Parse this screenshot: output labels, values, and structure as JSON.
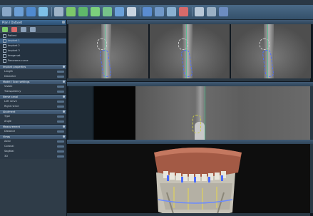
{
  "menu": [
    "",
    "",
    "",
    "",
    "",
    "",
    "",
    "",
    "",
    "",
    ""
  ],
  "toolbar": {
    "icons": [
      "open-icon",
      "save-icon",
      "import-icon",
      "export-icon",
      "layout-icon",
      "tooth-icon",
      "implant-icon",
      "nerve-icon",
      "crown-icon",
      "panorama-icon",
      "measure-icon",
      "move-icon",
      "zoom-icon",
      "pan-icon",
      "rotate-icon",
      "settings-icon",
      "print-icon",
      "help-icon"
    ]
  },
  "left_panel": {
    "title": "Plan / Dataset",
    "tree": [
      "Patient",
      "Implant 1",
      "Implant 2",
      "Implant 3",
      "Image set",
      "Panorama curve"
    ],
    "sections": [
      {
        "title": "Implant properties",
        "rows": [
          "Length",
          "Diameter"
        ]
      },
      {
        "title": "Model / Scan settings",
        "rows": [
          "Visible",
          "Transparency"
        ]
      },
      {
        "title": "Nerve canal",
        "rows": [
          "Left nerve",
          "Right nerve"
        ]
      },
      {
        "title": "Abutment",
        "rows": [
          "Type",
          "Angle"
        ]
      },
      {
        "title": "Measurement",
        "rows": [
          "Distance"
        ]
      },
      {
        "title": "Views",
        "rows": [
          "Axial",
          "Coronal",
          "Sagittal",
          "3D"
        ]
      }
    ]
  },
  "views": {
    "top_label": "",
    "middle_marker": "P",
    "bottom_marker": "A"
  },
  "colors": {
    "accent": "#3d6a94",
    "bone": "#c9c4b8",
    "gum": "#a75c45",
    "nerve": "#4c6cff"
  }
}
